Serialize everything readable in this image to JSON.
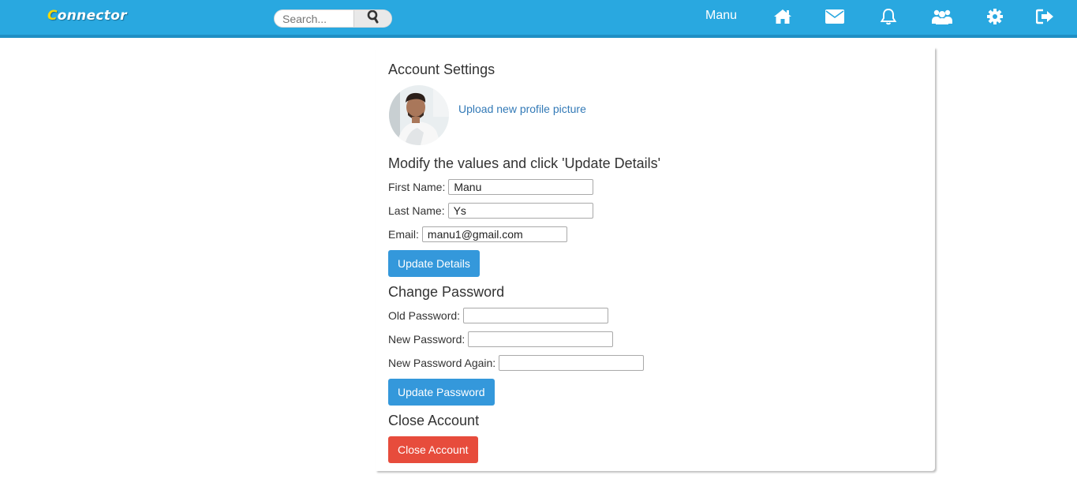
{
  "header": {
    "logo_first": "C",
    "logo_rest": "onnector",
    "search_placeholder": "Search...",
    "username": "Manu",
    "icons": [
      "home-icon",
      "envelope-icon",
      "bell-icon",
      "users-icon",
      "gear-icon",
      "sign-out-icon"
    ]
  },
  "settings": {
    "title": "Account Settings",
    "upload_link": "Upload new profile picture",
    "modify_heading": "Modify the values and click 'Update Details'",
    "first_name_label": "First Name:",
    "first_name_value": "Manu",
    "last_name_label": "Last Name:",
    "last_name_value": "Ys",
    "email_label": "Email:",
    "email_value": "manu1@gmail.com",
    "update_details_button": "Update Details",
    "change_password_heading": "Change Password",
    "old_password_label": "Old Password:",
    "new_password_label": "New Password:",
    "new_password_again_label": "New Password Again:",
    "update_password_button": "Update Password",
    "close_account_heading": "Close Account",
    "close_account_button": "Close Account"
  },
  "colors": {
    "header": "#29a8e0",
    "primary_button": "#3498db",
    "danger_button": "#e74c3c",
    "link": "#337ab7"
  }
}
